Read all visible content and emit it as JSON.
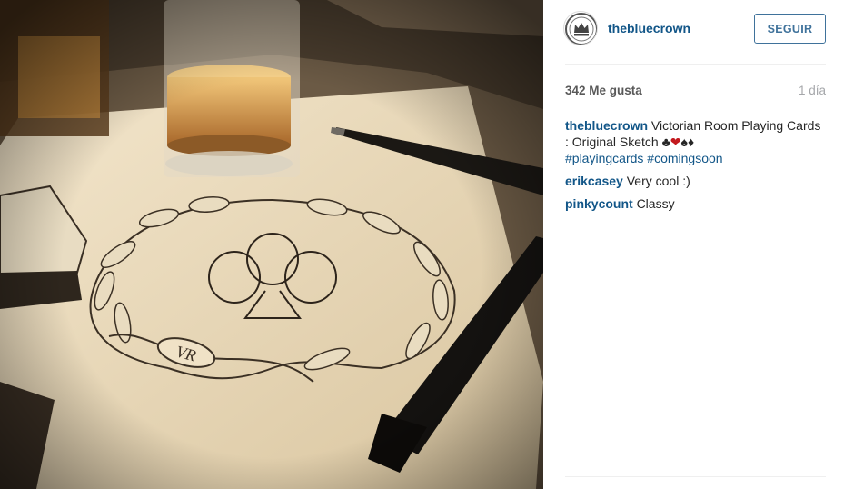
{
  "post": {
    "username": "thebluecrown",
    "follow_label": "SEGUIR",
    "likes": "342 Me gusta",
    "time_ago": "1 día",
    "caption": {
      "username": "thebluecrown",
      "text": "Victorian Room Playing Cards : Original Sketch ",
      "suits_a": "♣",
      "heart": "❤",
      "suits_b": "♠♦",
      "hashtags": [
        "#playingcards",
        "#comingsoon"
      ]
    },
    "comments": [
      {
        "username": "erikcasey",
        "text": "Very cool :)"
      },
      {
        "username": "pinkycount",
        "text": "Classy"
      }
    ]
  },
  "photo": {
    "monogram": "VR"
  },
  "colors": {
    "link": "#125688",
    "follow_border": "#3f729b",
    "heart": "#c3191e"
  }
}
